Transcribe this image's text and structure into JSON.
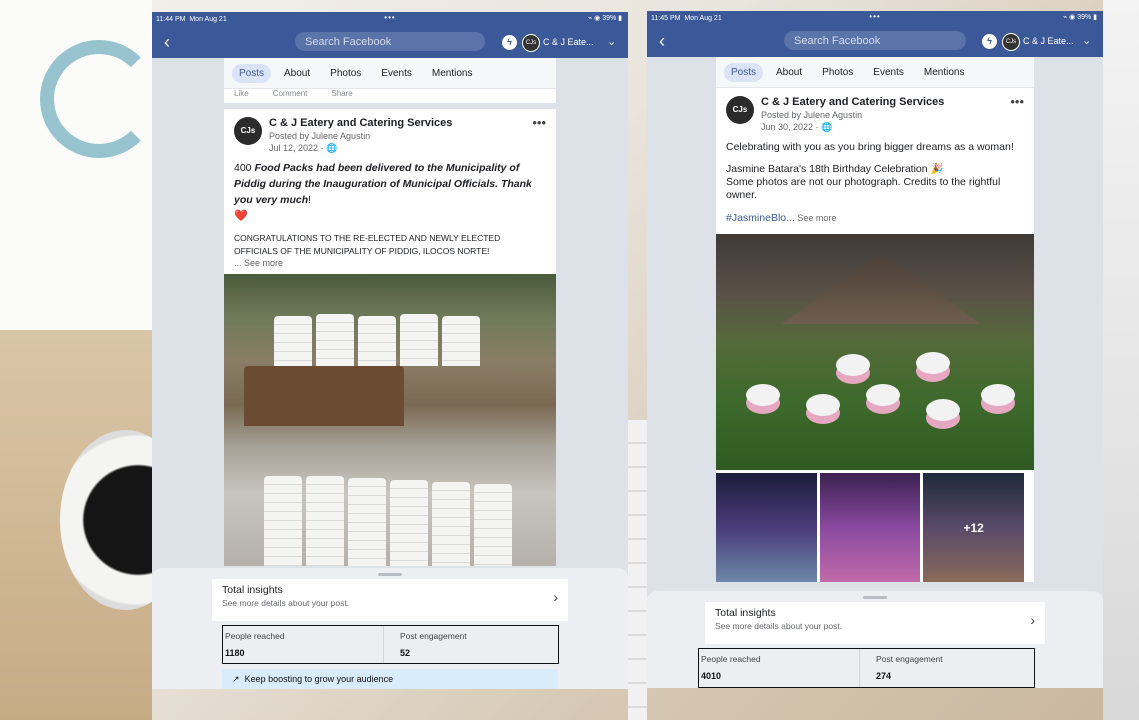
{
  "left_screen": {
    "status": {
      "time": "11:44 PM",
      "date": "Mon Aug 21",
      "battery": "39%"
    },
    "topbar": {
      "search_placeholder": "Search Facebook",
      "page_name": "C & J Eate..."
    },
    "tabs": [
      "Posts",
      "About",
      "Photos",
      "Events",
      "Mentions"
    ],
    "prev_actions": [
      "Like",
      "Comment",
      "Share"
    ],
    "post": {
      "logo_text": "CJs",
      "name": "C & J Eatery and Catering Services",
      "posted_by": "Posted by Julene Agustin",
      "date": "Jul 12, 2022 · ",
      "count": "400",
      "text_italic": "Food Packs had been delivered to the Municipality of Piddig during the Inauguration of Municipal Officials. Thank you very much",
      "exclaim": "!",
      "heart": "❤️",
      "caps_text": "CONGRATULATIONS TO THE RE-ELECTED AND NEWLY ELECTED OFFICIALS OF THE MUNICIPALITY OF PIDDIG, ILOCOS NORTE!",
      "see_more": "... See more"
    },
    "insights": {
      "title": "Total insights",
      "subtitle": "See more details about your post.",
      "people_reached_label": "People reached",
      "people_reached_value": "1180",
      "post_engagement_label": "Post engagement",
      "post_engagement_value": "52",
      "boost_text": "Keep boosting to grow your audience"
    }
  },
  "right_screen": {
    "status": {
      "time": "11:45 PM",
      "date": "Mon Aug 21",
      "battery": "39%"
    },
    "topbar": {
      "search_placeholder": "Search Facebook",
      "page_name": "C & J Eate..."
    },
    "tabs": [
      "Posts",
      "About",
      "Photos",
      "Events",
      "Mentions"
    ],
    "post": {
      "logo_text": "CJs",
      "name": "C & J Eatery and Catering Services",
      "posted_by": "Posted by Julene Agustin",
      "date": "Jun 30, 2022 · ",
      "line1": "Celebrating with you as you bring bigger dreams as a woman!",
      "line2": "Jasmine Batara's 18th Birthday Celebration 🎉",
      "line3": "Some photos are not our photograph. Credits to the rightful owner.",
      "hashtag": "#JasmineBlo...",
      "see_more": " See more",
      "more_photos": "+12"
    },
    "insights": {
      "title": "Total insights",
      "subtitle": "See more details about your post.",
      "people_reached_label": "People reached",
      "people_reached_value": "4010",
      "post_engagement_label": "Post engagement",
      "post_engagement_value": "274"
    }
  }
}
